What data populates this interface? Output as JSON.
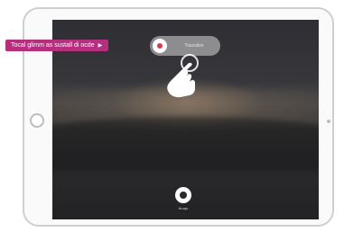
{
  "callout": {
    "text": "Tocal glimm as sustall di ocde",
    "arrow": "▶",
    "color": "#b52f7e"
  },
  "toggle": {
    "label": "Tusculisn",
    "state": "on",
    "indicator_color": "#d83a48"
  },
  "shutter": {
    "label": "Aruqo"
  },
  "icons": {
    "hand": "tap-hand-icon",
    "shutter": "shutter-icon",
    "home": "home-button-icon"
  }
}
